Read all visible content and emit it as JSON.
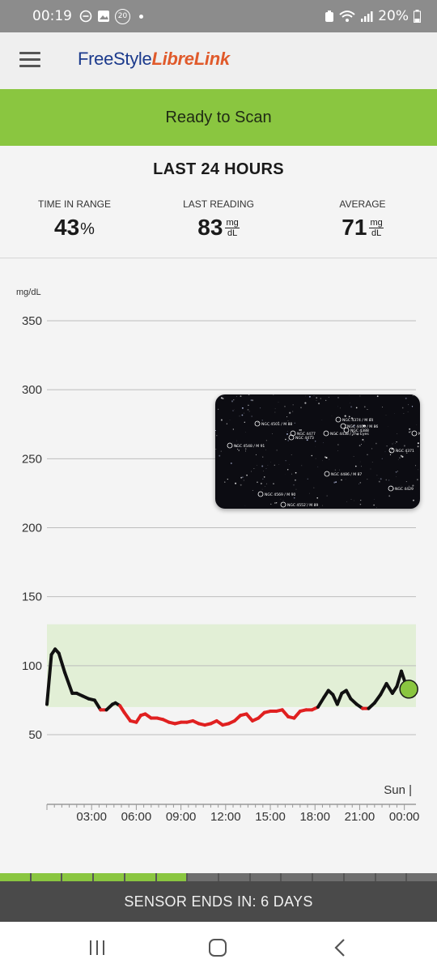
{
  "status_bar": {
    "time": "00:19",
    "notification_count": "20",
    "battery": "20%",
    "icons": [
      "do-not-disturb-icon",
      "gallery-icon",
      "badge-20-icon",
      "dot-icon",
      "alarm-icon",
      "wifi-icon",
      "signal-icon",
      "battery-icon"
    ]
  },
  "header": {
    "brand_part1": "FreeStyle",
    "brand_part2": "LibreLink",
    "menu_icon": "hamburger-icon"
  },
  "ready_button": {
    "label": "Ready to Scan"
  },
  "summary": {
    "title": "LAST 24 HOURS",
    "time_in_range": {
      "label": "TIME IN RANGE",
      "value": "43",
      "unit": "%"
    },
    "last_reading": {
      "label": "LAST READING",
      "value": "83",
      "unit_top": "mg",
      "unit_bottom": "dL"
    },
    "average": {
      "label": "AVERAGE",
      "value": "71",
      "unit_top": "mg",
      "unit_bottom": "dL"
    }
  },
  "chart_data": {
    "type": "line",
    "ylabel": "mg/dL",
    "ylim": [
      30,
      355
    ],
    "yticks": [
      350,
      300,
      250,
      200,
      150,
      100,
      50
    ],
    "target_range": [
      70,
      130
    ],
    "xlim": [
      0,
      24
    ],
    "xticks": [
      {
        "h": 3,
        "label": "03:00"
      },
      {
        "h": 6,
        "label": "06:00"
      },
      {
        "h": 9,
        "label": "09:00"
      },
      {
        "h": 12,
        "label": "12:00"
      },
      {
        "h": 15,
        "label": "15:00"
      },
      {
        "h": 18,
        "label": "18:00"
      },
      {
        "h": 21,
        "label": "21:00"
      },
      {
        "h": 24,
        "label": "00:00"
      }
    ],
    "day_marker": {
      "h": 24,
      "label": "Sun |"
    },
    "colors": {
      "normal": "#111111",
      "low": "#e02020",
      "range_fill": "#e2efd6",
      "grid": "#bdbdbd",
      "current": "#8ac640"
    },
    "low_threshold": 70,
    "points": [
      [
        0.0,
        72
      ],
      [
        0.3,
        108
      ],
      [
        0.55,
        112
      ],
      [
        0.8,
        109
      ],
      [
        1.2,
        95
      ],
      [
        1.7,
        80
      ],
      [
        2.0,
        80
      ],
      [
        2.4,
        78
      ],
      [
        2.8,
        76
      ],
      [
        3.2,
        75
      ],
      [
        3.6,
        68
      ],
      [
        4.0,
        68
      ],
      [
        4.4,
        72
      ],
      [
        4.6,
        73
      ],
      [
        4.9,
        71
      ],
      [
        5.2,
        66
      ],
      [
        5.6,
        60
      ],
      [
        6.0,
        59
      ],
      [
        6.3,
        64
      ],
      [
        6.6,
        65
      ],
      [
        7.0,
        62
      ],
      [
        7.4,
        62
      ],
      [
        7.8,
        61
      ],
      [
        8.2,
        59
      ],
      [
        8.6,
        58
      ],
      [
        9.0,
        59
      ],
      [
        9.4,
        59
      ],
      [
        9.8,
        60
      ],
      [
        10.2,
        58
      ],
      [
        10.6,
        57
      ],
      [
        11.0,
        58
      ],
      [
        11.4,
        60
      ],
      [
        11.8,
        57
      ],
      [
        12.2,
        58
      ],
      [
        12.6,
        60
      ],
      [
        13.0,
        64
      ],
      [
        13.4,
        65
      ],
      [
        13.8,
        60
      ],
      [
        14.2,
        62
      ],
      [
        14.6,
        66
      ],
      [
        15.0,
        67
      ],
      [
        15.4,
        67
      ],
      [
        15.8,
        68
      ],
      [
        16.2,
        63
      ],
      [
        16.6,
        62
      ],
      [
        17.0,
        67
      ],
      [
        17.4,
        68
      ],
      [
        17.8,
        68
      ],
      [
        18.2,
        70
      ],
      [
        18.6,
        77
      ],
      [
        18.9,
        82
      ],
      [
        19.2,
        79
      ],
      [
        19.5,
        72
      ],
      [
        19.8,
        80
      ],
      [
        20.1,
        82
      ],
      [
        20.4,
        76
      ],
      [
        20.8,
        72
      ],
      [
        21.2,
        69
      ],
      [
        21.6,
        69
      ],
      [
        22.0,
        73
      ],
      [
        22.4,
        79
      ],
      [
        22.8,
        87
      ],
      [
        23.2,
        80
      ],
      [
        23.5,
        85
      ],
      [
        23.8,
        96
      ],
      [
        24.2,
        83
      ]
    ],
    "current_reading": [
      24.3,
      83
    ]
  },
  "overlay": {
    "labels": [
      "NGC 4501 / M 88",
      "NGC 4374 / M 84",
      "NGC 4406 / M 86",
      "NGC 4388",
      "NGC 4438 / The Eyes",
      "NGC 4477",
      "NGC 4473",
      "NGC 4548 / M 91",
      "NGC 4371",
      "NGC 4486 / M 87",
      "NGC 4569 / M 90",
      "NGC 4552 / M 89",
      "NGC 4429",
      "NGC 43"
    ]
  },
  "sensor": {
    "label": "SENSOR ENDS IN: 6 DAYS",
    "segments": [
      "used",
      "used",
      "used",
      "used",
      "used",
      "used",
      "remaining",
      "remaining",
      "remaining",
      "remaining",
      "remaining",
      "remaining",
      "remaining",
      "remaining"
    ]
  },
  "nav": {
    "recents": "recents-icon",
    "home": "home-icon",
    "back": "back-icon"
  }
}
